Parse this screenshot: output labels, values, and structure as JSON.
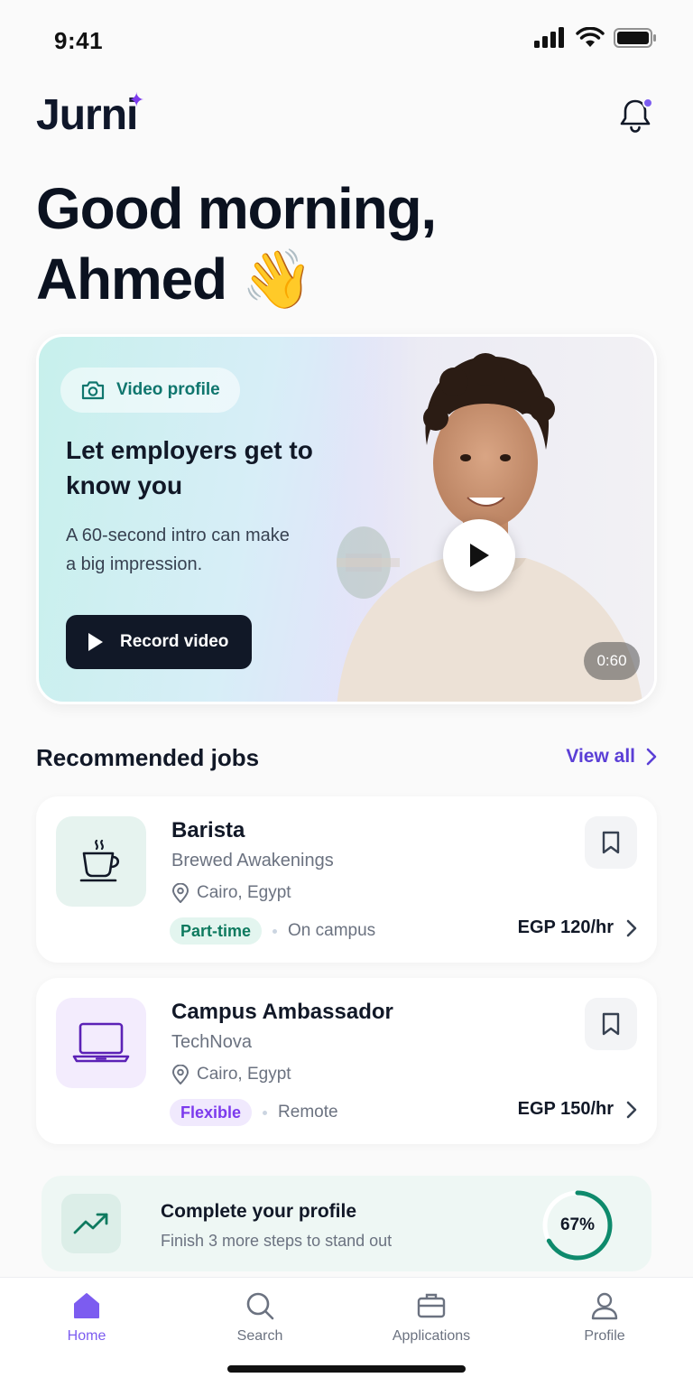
{
  "status_bar": {
    "time": "9:41"
  },
  "header": {
    "logo": "Jurni"
  },
  "greeting": {
    "line1": "Good morning,",
    "line2": "Ahmed 👋"
  },
  "hero": {
    "chip_label": "Video profile",
    "title": "Let employers get to know you",
    "subtitle": "A 60-second intro can make a big impression.",
    "button_label": "Record video",
    "duration": "0:60"
  },
  "recommended": {
    "title": "Recommended jobs",
    "view_all": "View all",
    "jobs": [
      {
        "title": "Barista",
        "company": "Brewed Awakenings",
        "location": "Cairo, Egypt",
        "tag": "Part-time",
        "mode": "On campus",
        "pay": "EGP 120/hr",
        "icon": "coffee-cup-icon"
      },
      {
        "title": "Campus Ambassador",
        "company": "TechNova",
        "location": "Cairo, Egypt",
        "tag": "Flexible",
        "mode": "Remote",
        "pay": "EGP 150/hr",
        "icon": "laptop-icon"
      }
    ]
  },
  "profile_banner": {
    "title": "Complete your profile",
    "subtitle": "Finish 3 more steps to stand out",
    "progress_label": "67%",
    "progress": 0.67
  },
  "tabbar": {
    "items": [
      {
        "label": "Home",
        "icon": "home-icon",
        "active": true
      },
      {
        "label": "Search",
        "icon": "search-icon",
        "active": false
      },
      {
        "label": "Applications",
        "icon": "briefcase-icon",
        "active": false
      },
      {
        "label": "Profile",
        "icon": "user-icon",
        "active": false
      }
    ]
  },
  "colors": {
    "accent": "#7c5cf0",
    "teal": "#0e7a5f",
    "dark": "#111827"
  }
}
